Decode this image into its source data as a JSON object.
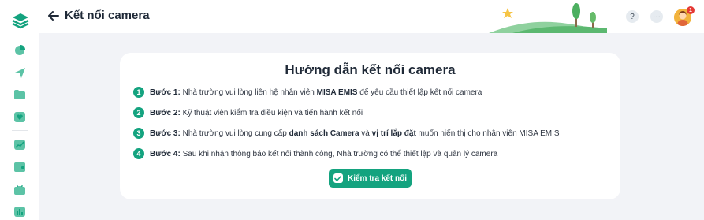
{
  "header": {
    "title": "Kết nối camera",
    "help_label": "?",
    "more_label": "···",
    "notification_count": "1"
  },
  "sidebar": {
    "items": [
      {
        "icon": "pie-chart-icon"
      },
      {
        "icon": "send-icon"
      },
      {
        "icon": "folder-icon"
      },
      {
        "icon": "heart-card-icon"
      },
      {
        "icon": "trend-chart-icon"
      },
      {
        "icon": "wallet-icon"
      },
      {
        "icon": "briefcase-icon"
      },
      {
        "icon": "bar-chart-icon"
      }
    ]
  },
  "guide": {
    "title": "Hướng dẫn kết nối camera",
    "steps": [
      {
        "num": "1",
        "label": "Bước 1:",
        "text_a": " Nhà trường vui lòng liên hệ nhân viên ",
        "bold_a": "MISA EMIS",
        "text_b": " để yêu cầu thiết lập kết nối camera"
      },
      {
        "num": "2",
        "label": "Bước 2:",
        "text_a": " Kỹ thuật viên kiểm tra điều kiện và tiến hành kết nối"
      },
      {
        "num": "3",
        "label": "Bước 3:",
        "text_a": " Nhà trường vui lòng cung cấp ",
        "bold_a": "danh sách Camera",
        "text_b": " và ",
        "bold_b": "vị trí lắp đặt",
        "text_c": " muốn hiển thị cho nhân viên MISA EMIS"
      },
      {
        "num": "4",
        "label": "Bước 4:",
        "text_a": " Sau khi nhận thông báo kết nối thành công, Nhà trường có thể thiết lập và quản lý camera"
      }
    ],
    "button_label": "Kiểm tra kết nối"
  },
  "colors": {
    "accent": "#14a37f",
    "badge": "#e53935",
    "background": "#f2f3f7"
  }
}
